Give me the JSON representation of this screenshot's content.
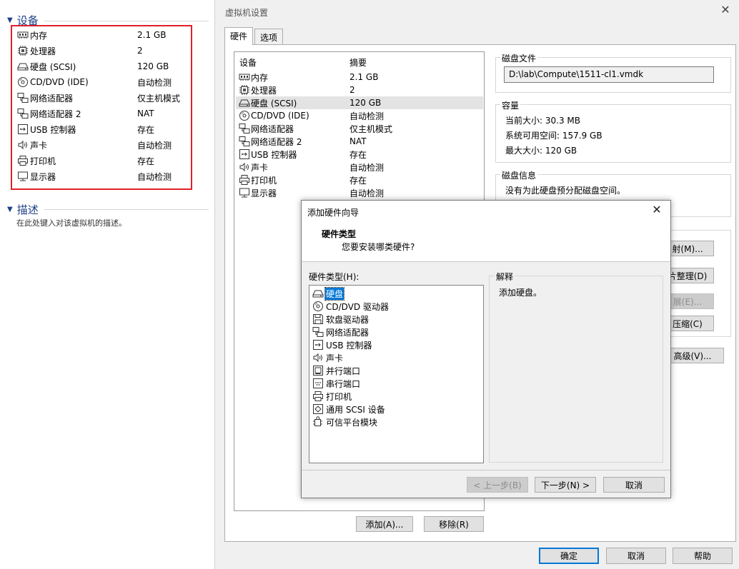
{
  "left": {
    "devices_heading": "设备",
    "devices": [
      {
        "icon": "memory-icon",
        "name": "内存",
        "value": "2.1 GB"
      },
      {
        "icon": "cpu-icon",
        "name": "处理器",
        "value": "2"
      },
      {
        "icon": "hard-disk-icon",
        "name": "硬盘 (SCSI)",
        "value": "120 GB"
      },
      {
        "icon": "cd-dvd-icon",
        "name": "CD/DVD (IDE)",
        "value": "自动检测"
      },
      {
        "icon": "network-adapter-icon",
        "name": "网络适配器",
        "value": "仅主机模式"
      },
      {
        "icon": "network-adapter-icon",
        "name": "网络适配器 2",
        "value": "NAT"
      },
      {
        "icon": "usb-icon",
        "name": "USB 控制器",
        "value": "存在"
      },
      {
        "icon": "sound-icon",
        "name": "声卡",
        "value": "自动检测"
      },
      {
        "icon": "printer-icon",
        "name": "打印机",
        "value": "存在"
      },
      {
        "icon": "display-icon",
        "name": "显示器",
        "value": "自动检测"
      }
    ],
    "description_heading": "描述",
    "description_placeholder": "在此处键入对该虚拟机的描述。"
  },
  "dialog": {
    "title": "虚拟机设置",
    "close": "✕",
    "tabs": [
      {
        "label": "硬件"
      },
      {
        "label": "选项"
      }
    ],
    "device_list": {
      "col_device": "设备",
      "col_summary": "摘要",
      "selected_index": 2,
      "rows": [
        {
          "icon": "memory-icon",
          "name": "内存",
          "value": "2.1 GB"
        },
        {
          "icon": "cpu-icon",
          "name": "处理器",
          "value": "2"
        },
        {
          "icon": "hard-disk-icon",
          "name": "硬盘 (SCSI)",
          "value": "120 GB"
        },
        {
          "icon": "cd-dvd-icon",
          "name": "CD/DVD (IDE)",
          "value": "自动检测"
        },
        {
          "icon": "network-adapter-icon",
          "name": "网络适配器",
          "value": "仅主机模式"
        },
        {
          "icon": "network-adapter-icon",
          "name": "网络适配器 2",
          "value": "NAT"
        },
        {
          "icon": "usb-icon",
          "name": "USB 控制器",
          "value": "存在"
        },
        {
          "icon": "sound-icon",
          "name": "声卡",
          "value": "自动检测"
        },
        {
          "icon": "printer-icon",
          "name": "打印机",
          "value": "存在"
        },
        {
          "icon": "display-icon",
          "name": "显示器",
          "value": "自动检测"
        }
      ]
    },
    "disk_file": {
      "label": "磁盘文件",
      "path": "D:\\lab\\Compute\\1511-cl1.vmdk"
    },
    "capacity": {
      "label": "容量",
      "current": "当前大小: 30.3 MB",
      "system_free": "系统可用空间: 157.9 GB",
      "max": "最大大小: 120 GB"
    },
    "disk_info": {
      "label": "磁盘信息",
      "text": "没有为此硬盘预分配磁盘空间。"
    },
    "utility_buttons": {
      "map": "射(M)...",
      "defrag": "片整理(D)",
      "expand": "展(E)...",
      "compact": "压缩(C)"
    },
    "advanced_button": "高级(V)...",
    "add_button": "添加(A)...",
    "remove_button": "移除(R)",
    "ok_button": "确定",
    "cancel_button": "取消",
    "help_button": "帮助"
  },
  "wizard": {
    "title": "添加硬件向导",
    "close": "✕",
    "header_title": "硬件类型",
    "header_subtitle": "您要安装哪类硬件?",
    "list_label": "硬件类型(H):",
    "selected_index": 0,
    "types": [
      {
        "icon": "hard-disk-icon",
        "name": "硬盘"
      },
      {
        "icon": "cd-dvd-icon",
        "name": "CD/DVD 驱动器"
      },
      {
        "icon": "floppy-icon",
        "name": "软盘驱动器"
      },
      {
        "icon": "network-adapter-icon",
        "name": "网络适配器"
      },
      {
        "icon": "usb-icon",
        "name": "USB 控制器"
      },
      {
        "icon": "sound-icon",
        "name": "声卡"
      },
      {
        "icon": "parallel-port-icon",
        "name": "并行端口"
      },
      {
        "icon": "serial-port-icon",
        "name": "串行端口"
      },
      {
        "icon": "printer-icon",
        "name": "打印机"
      },
      {
        "icon": "scsi-device-icon",
        "name": "通用 SCSI 设备"
      },
      {
        "icon": "tpm-icon",
        "name": "可信平台模块"
      }
    ],
    "explain_label": "解释",
    "explain_text": "添加硬盘。",
    "back_button": "< 上一步(B)",
    "next_button": "下一步(N) >",
    "cancel_button": "取消"
  },
  "colors": {
    "accent": "#0078d7",
    "highlight_border": "#e0202a",
    "section_heading": "#1e3f88"
  }
}
